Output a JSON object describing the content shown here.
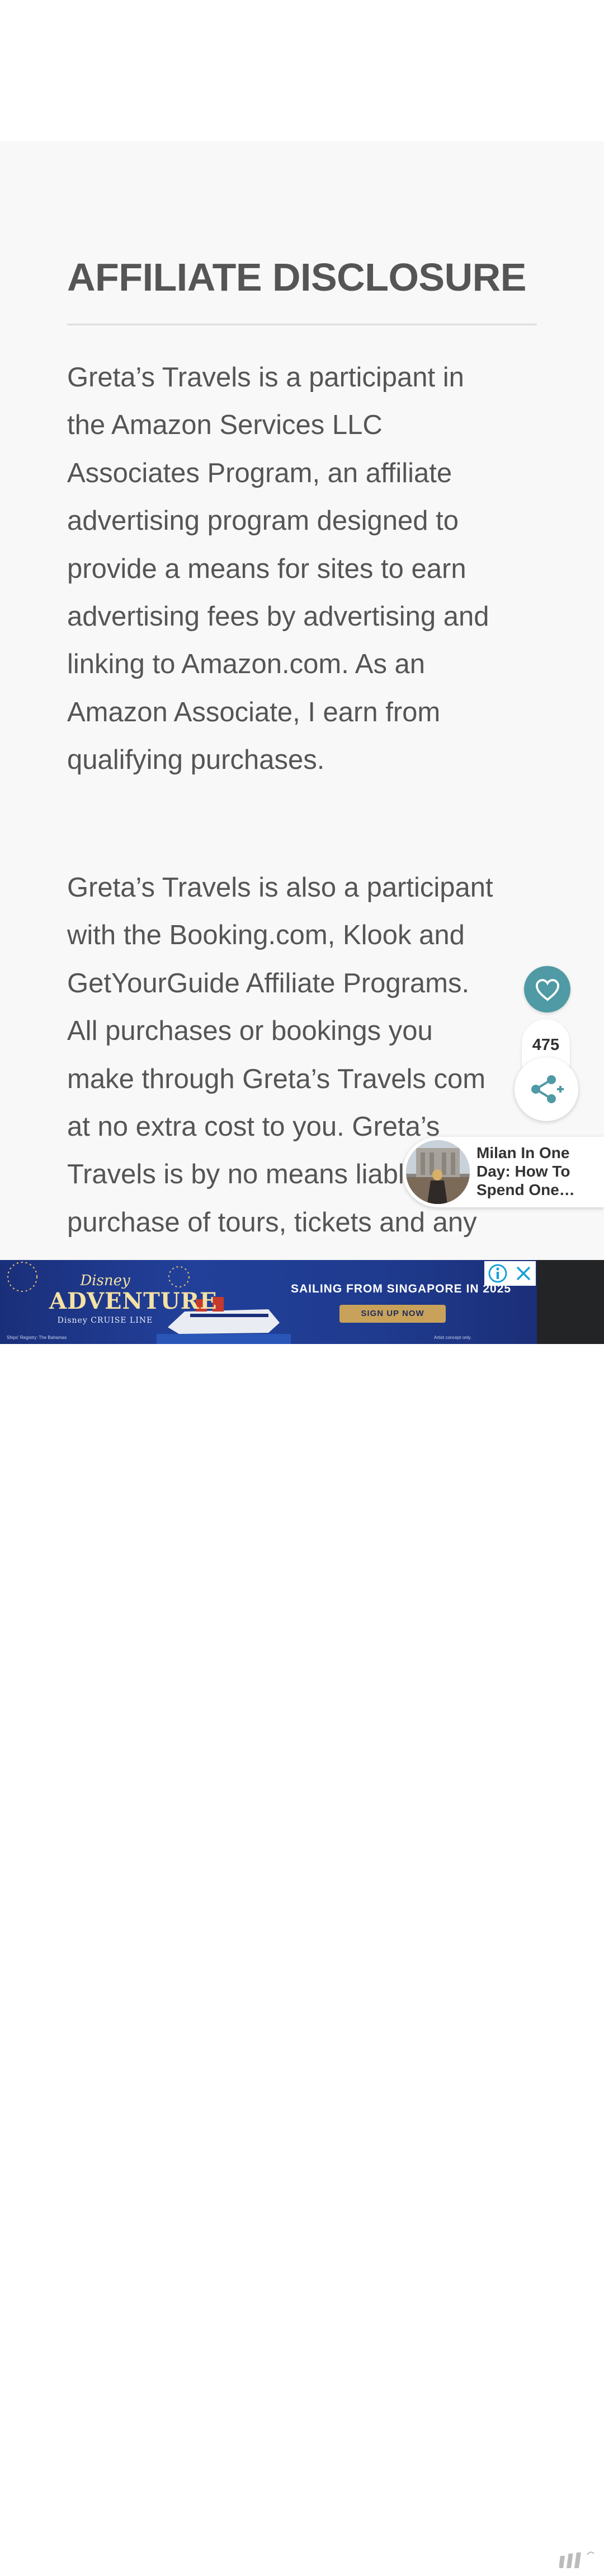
{
  "article": {
    "heading": "AFFILIATE DISCLOSURE",
    "paragraph1_lines": [
      "Greta’s Travels is a participant in",
      "the Amazon Services LLC",
      "Associates Program, an affiliate",
      "advertising program designed to",
      "provide a means for sites to earn",
      "advertising fees by advertising and",
      "linking to Amazon.com. As an",
      "Amazon Associate, I earn from",
      "qualifying purchases."
    ],
    "paragraph2_lines": [
      "Greta’s Travels is also a participant",
      "with the Booking.com, Klook and",
      "GetYourGuide Affiliate Programs.",
      "All purchases or bookings you",
      "make through Greta’s Travels com",
      "at no extra cost to you. Greta’s",
      "Travels is by no means liable",
      "purchase of tours, tickets and any"
    ]
  },
  "social": {
    "heart_icon": "heart-icon",
    "share_count": "475",
    "share_icon": "share-plus-icon",
    "accent_color": "#4f9aa4"
  },
  "related_post": {
    "title_lines": [
      "Milan In One",
      "Day: How To",
      "Spend One…"
    ]
  },
  "ad": {
    "brand_top": "Disney",
    "brand_main": "ADVENTURE",
    "brand_bottom": "Disney CRUISE LINE",
    "headline": "SAILING FROM SINGAPORE IN 2025",
    "cta": "SIGN UP NOW",
    "fine_left": "Ships' Registry: The Bahamas",
    "fine_right": "Artist concept only.",
    "info_icon": "info-icon",
    "close_icon": "close-icon"
  }
}
